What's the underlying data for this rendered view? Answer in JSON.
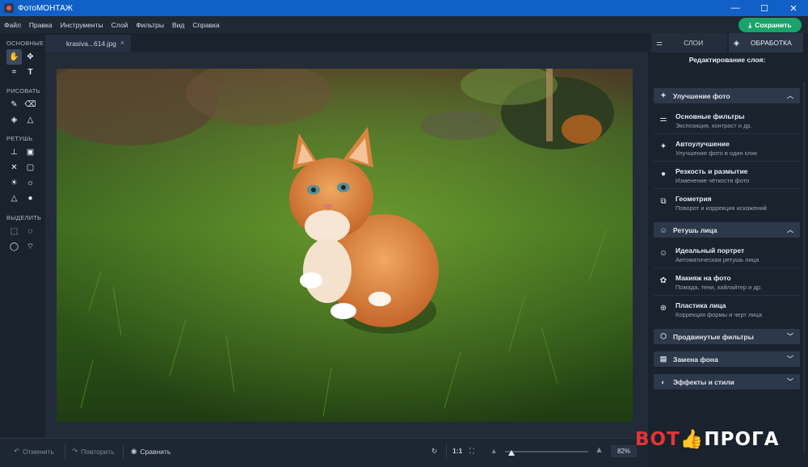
{
  "app": {
    "title": "ФотоМОНТАЖ"
  },
  "window": {
    "minimize": "—",
    "maximize": "☐",
    "close": "✕"
  },
  "menu": [
    "Файл",
    "Правка",
    "Инструменты",
    "Слой",
    "Фильтры",
    "Вид",
    "Справка"
  ],
  "save_button": {
    "label": "Сохранить",
    "icon": "download-icon",
    "color": "#1aa36a"
  },
  "toolbar": {
    "sections": [
      {
        "label": "ОСНОВНЫЕ",
        "tools": [
          {
            "name": "hand-tool",
            "glyph": "✋"
          },
          {
            "name": "move-tool",
            "glyph": "✥"
          },
          {
            "name": "crop-tool",
            "glyph": "⌗"
          },
          {
            "name": "text-tool",
            "glyph": "T"
          }
        ]
      },
      {
        "label": "РИСОВАТЬ",
        "tools": [
          {
            "name": "brush-tool",
            "glyph": "✎"
          },
          {
            "name": "eraser-tool",
            "glyph": "⌫"
          },
          {
            "name": "fill-tool",
            "glyph": "◈"
          },
          {
            "name": "shapes-tool",
            "glyph": "△"
          }
        ]
      },
      {
        "label": "РЕТУШЬ",
        "tools": [
          {
            "name": "stamp-tool",
            "glyph": "⊥"
          },
          {
            "name": "patch-tool",
            "glyph": "▣"
          },
          {
            "name": "healing-tool",
            "glyph": "✕"
          },
          {
            "name": "frame-tool",
            "glyph": "▢"
          },
          {
            "name": "dodge-tool",
            "glyph": "☀"
          },
          {
            "name": "burn-tool",
            "glyph": "☼"
          },
          {
            "name": "sharpen-tool",
            "glyph": "△"
          },
          {
            "name": "blur-tool",
            "glyph": "●"
          }
        ]
      },
      {
        "label": "ВЫДЕЛИТЬ",
        "tools": [
          {
            "name": "rect-select-tool",
            "glyph": "⬚"
          },
          {
            "name": "ellipse-select-tool",
            "glyph": "◌"
          },
          {
            "name": "lasso-tool",
            "glyph": "◯"
          },
          {
            "name": "poly-lasso-tool",
            "glyph": "⌔"
          }
        ]
      }
    ]
  },
  "document_tab": {
    "name": "krasiva...614.jpg",
    "close": "×"
  },
  "bottom": {
    "undo": "Отменить",
    "redo": "Повторить",
    "compare": "Сравнить",
    "ratio": "1:1",
    "zoom": "82%",
    "zoom_level": 0.08
  },
  "panel": {
    "tabs": [
      {
        "label": "СЛОИ",
        "icon": "sliders-icon"
      },
      {
        "label": "ОБРАБОТКА",
        "icon": "layers-icon"
      }
    ],
    "title": "Редактирование слоя:",
    "groups": [
      {
        "label": "Улучшение фото",
        "icon": "magic-wand-icon",
        "expanded": true,
        "items": [
          {
            "title": "Основные фильтры",
            "subtitle": "Экспозиция, контраст и др.",
            "icon": "sliders-icon",
            "glyph": "⚌"
          },
          {
            "title": "Автоулучшение",
            "subtitle": "Улучшение фото в один клик",
            "icon": "magic-wand-icon",
            "glyph": "✦"
          },
          {
            "title": "Резкость и размытие",
            "subtitle": "Изменение чёткости фото",
            "icon": "drop-icon",
            "glyph": "💧"
          },
          {
            "title": "Геометрия",
            "subtitle": "Поворот и коррекция искажений",
            "icon": "geometry-icon",
            "glyph": "⧉"
          }
        ]
      },
      {
        "label": "Ретушь лица",
        "icon": "face-retouch-icon",
        "expanded": true,
        "items": [
          {
            "title": "Идеальный портрет",
            "subtitle": "Автоматическая ретушь лица",
            "icon": "portrait-icon",
            "glyph": "☺"
          },
          {
            "title": "Макияж на фото",
            "subtitle": "Помада, тени, хайлайтер и др.",
            "icon": "makeup-icon",
            "glyph": "✿"
          },
          {
            "title": "Пластика лица",
            "subtitle": "Коррекция формы и черт лица",
            "icon": "face-shape-icon",
            "glyph": "⊕"
          }
        ]
      },
      {
        "label": "Продвинутые фильтры",
        "icon": "filters-icon",
        "expanded": false,
        "items": []
      },
      {
        "label": "Замена фона",
        "icon": "background-icon",
        "expanded": false,
        "items": []
      },
      {
        "label": "Эффекты и стили",
        "icon": "effects-icon",
        "expanded": false,
        "items": []
      }
    ]
  },
  "watermark": {
    "left": "ВОТ",
    "right": "ПРОГА"
  }
}
